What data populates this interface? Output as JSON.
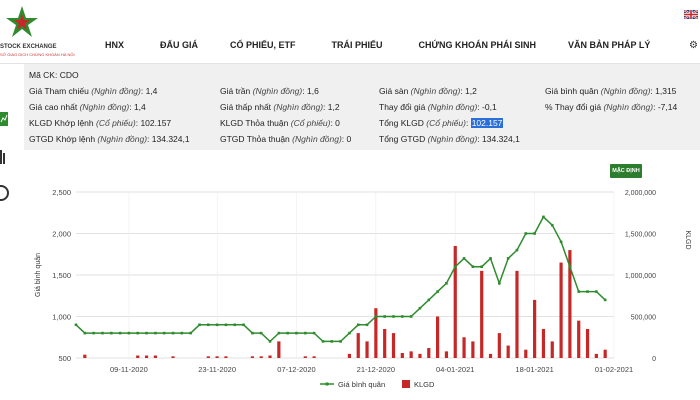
{
  "header": {
    "logo_text": "STOCK EXCHANGE",
    "logo_sub": "SỞ GIAO DỊCH CHỨNG KHOÁN HÀ NỘI",
    "nav": [
      "HNX",
      "ĐẤU GIÁ",
      "CỔ PHIẾU, ETF",
      "TRÁI PHIẾU",
      "CHỨNG KHOÁN PHÁI SINH",
      "VĂN BẢN PHÁP LÝ"
    ]
  },
  "info": {
    "title": "Mã CK: CDO",
    "col1": [
      {
        "label": "Giá Tham chiếu",
        "unit": "(Nghìn đồng)",
        "value": "1,4"
      },
      {
        "label": "Giá cao nhất",
        "unit": "(Nghìn đồng)",
        "value": "1,4"
      },
      {
        "label": "KLGD Khớp lệnh",
        "unit": "(Cổ phiếu)",
        "value": "102.157"
      },
      {
        "label": "GTGD Khớp lệnh",
        "unit": "(Nghìn đồng)",
        "value": "134.324,1"
      }
    ],
    "col2": [
      {
        "label": "Giá trần",
        "unit": "(Nghìn đồng)",
        "value": "1,6"
      },
      {
        "label": "Giá thấp nhất",
        "unit": "(Nghìn đồng)",
        "value": "1,2"
      },
      {
        "label": "KLGD Thỏa thuận",
        "unit": "(Cổ phiếu)",
        "value": "0"
      },
      {
        "label": "GTGD Thỏa thuận",
        "unit": "(Nghìn đồng)",
        "value": "0"
      }
    ],
    "col3": [
      {
        "label": "Giá sàn",
        "unit": "(Nghìn đồng)",
        "value": "1,2"
      },
      {
        "label": "Thay đổi giá",
        "unit": "(Nghìn đồng)",
        "value": "-0,1"
      },
      {
        "label": "Tổng KLGD",
        "unit": "(Cổ phiếu)",
        "value": "102.157"
      },
      {
        "label": "Tổng GTGD",
        "unit": "(Nghìn đồng)",
        "value": "134.324,1"
      }
    ],
    "col4": [
      {
        "label": "Giá bình quân",
        "unit": "(Nghìn đồng)",
        "value": "1,315"
      },
      {
        "label": "% Thay đổi giá",
        "unit": "(Nghìn đồng)",
        "value": "-7,14"
      }
    ]
  },
  "default_button": "MẶC ĐỊNH",
  "colors": {
    "line": "#2e8b2e",
    "bar": "#c62828",
    "header_bg": "#ffffff",
    "info_bg": "#f0f0f0"
  },
  "chart_data": {
    "type": "bar",
    "title": "",
    "y_left_label": "Giá bình quân",
    "y_right_label": "KLGD",
    "y_left_ticks": [
      "2,500",
      "2,000",
      "1,500",
      "1,000",
      "500"
    ],
    "y_left_range": [
      500,
      2500
    ],
    "y_right_ticks": [
      "2,000,000",
      "1,500,000",
      "1,000,000",
      "500,000",
      "0"
    ],
    "y_right_range": [
      0,
      2000000
    ],
    "x_tick_labels": [
      "09-11-2020",
      "23-11-2020",
      "07-12-2020",
      "21-12-2020",
      "04-01-2021",
      "18-01-2021",
      "01-02-2021"
    ],
    "x_range": [
      0,
      61
    ],
    "x_tick_positions": [
      6,
      16,
      25,
      34,
      43,
      52,
      61
    ],
    "legend": [
      "Giá bình quân",
      "KLGD"
    ],
    "price_series": {
      "name": "Giá bình quân",
      "x": [
        0,
        1,
        2,
        3,
        4,
        5,
        6,
        7,
        8,
        9,
        10,
        11,
        12,
        13,
        14,
        15,
        16,
        17,
        18,
        19,
        20,
        21,
        22,
        23,
        24,
        25,
        26,
        27,
        28,
        29,
        30,
        31,
        32,
        33,
        34,
        35,
        36,
        37,
        38,
        39,
        40,
        41,
        42,
        43,
        44,
        45,
        46,
        47,
        48,
        49,
        50,
        51,
        52,
        53,
        54,
        55,
        56,
        57,
        58,
        59,
        60
      ],
      "y": [
        900,
        800,
        800,
        800,
        800,
        800,
        800,
        800,
        800,
        800,
        800,
        800,
        800,
        800,
        900,
        900,
        900,
        900,
        900,
        900,
        800,
        800,
        700,
        800,
        800,
        800,
        800,
        800,
        700,
        700,
        700,
        800,
        900,
        900,
        1000,
        1000,
        1000,
        1000,
        1000,
        1100,
        1200,
        1300,
        1400,
        1600,
        1700,
        1600,
        1600,
        1700,
        1400,
        1700,
        1800,
        2000,
        2000,
        2200,
        2100,
        1900,
        1600,
        1300,
        1300,
        1300,
        1200
      ]
    },
    "volume_series": {
      "name": "KLGD",
      "x": [
        1,
        7,
        8,
        9,
        11,
        15,
        16,
        17,
        20,
        21,
        22,
        23,
        26,
        27,
        31,
        32,
        33,
        34,
        35,
        36,
        37,
        38,
        39,
        40,
        41,
        42,
        43,
        44,
        45,
        46,
        47,
        48,
        49,
        50,
        51,
        52,
        53,
        54,
        55,
        56,
        57,
        58,
        59,
        60
      ],
      "y": [
        40000,
        30000,
        30000,
        30000,
        20000,
        20000,
        20000,
        20000,
        20000,
        20000,
        30000,
        200000,
        20000,
        20000,
        50000,
        300000,
        200000,
        600000,
        350000,
        300000,
        60000,
        80000,
        50000,
        120000,
        500000,
        80000,
        1350000,
        250000,
        200000,
        1050000,
        50000,
        300000,
        150000,
        1050000,
        100000,
        700000,
        350000,
        200000,
        1150000,
        1300000,
        450000,
        350000,
        50000,
        100000
      ]
    }
  }
}
